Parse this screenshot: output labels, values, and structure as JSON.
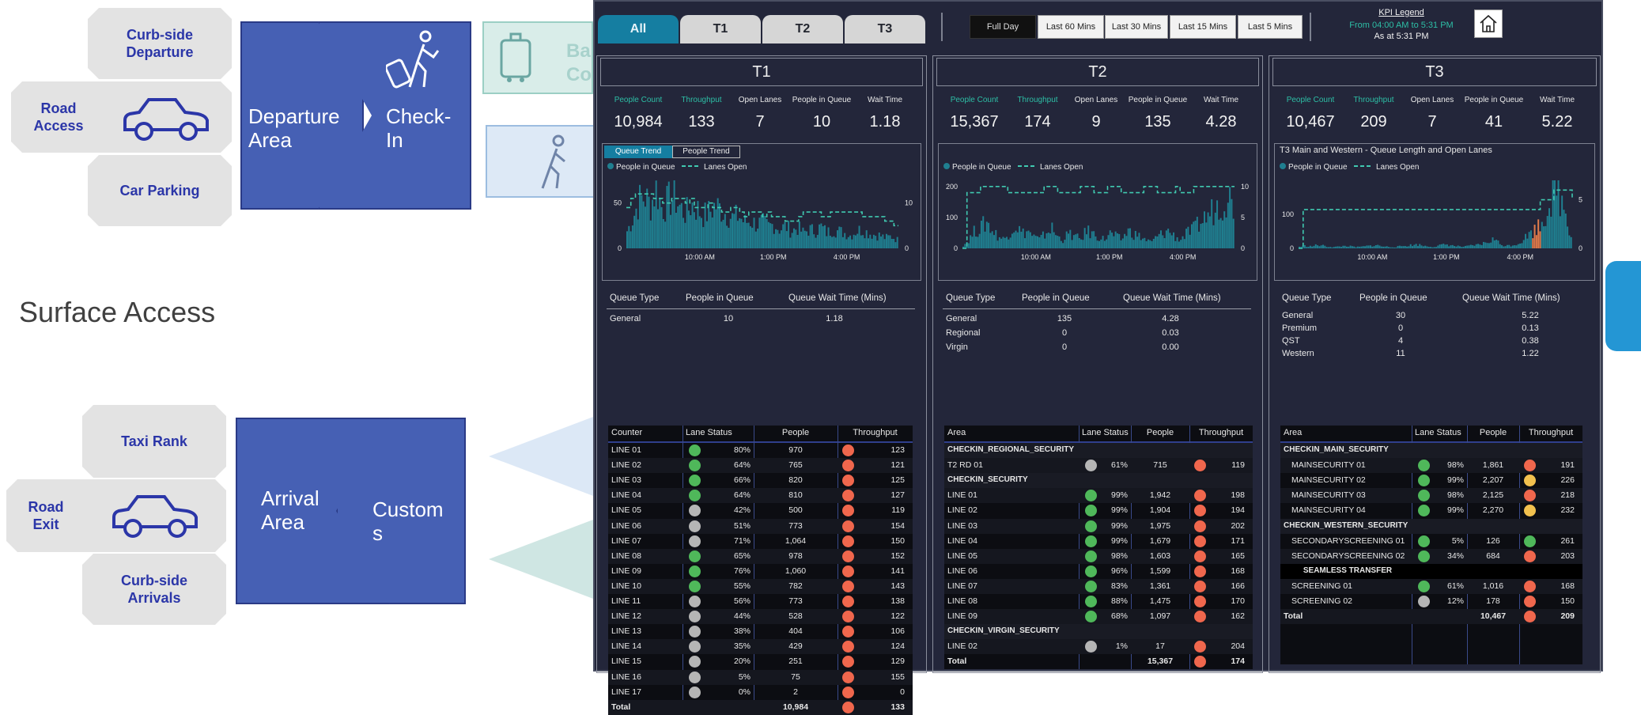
{
  "diagram": {
    "departure": {
      "tickets": [
        "Curb-side Departure",
        "Road Access",
        "Car Parking"
      ],
      "area_label": "Departure Area",
      "next_label": "Check-In"
    },
    "surface_access": "Surface Access",
    "arrival": {
      "tickets": [
        "Taxi Rank",
        "Road Exit",
        "Curb-side Arrivals"
      ],
      "area_label": "Arrival Area",
      "next_label": "Customs"
    },
    "partial_labels": [
      "Ba",
      "Co"
    ]
  },
  "dashboard": {
    "tabs": [
      "All",
      "T1",
      "T2",
      "T3"
    ],
    "active_tab": "All",
    "time_buttons": [
      "Full Day",
      "Last 60 Mins",
      "Last 30 Mins",
      "Last 15 Mins",
      "Last 5 Mins"
    ],
    "active_time": "Full Day",
    "kpi_legend": {
      "title": "KPI Legend",
      "range": "From 04:00 AM to 5:31 PM",
      "as_at": "As at 5:31 PM"
    },
    "home_icon": "home-icon",
    "colors": {
      "teal": "#2dbfa6",
      "bar": "#1f7f90",
      "lane": "#40c9b0",
      "green": "#4fb85a",
      "grey": "#b5b5b5",
      "red": "#f0674d",
      "yellow": "#f2c14e",
      "highlight": "#e07a4a"
    },
    "panels": [
      {
        "title": "T1",
        "kpi_labels": [
          "People Count",
          "Throughput",
          "Open Lanes",
          "People in Queue",
          "Wait Time"
        ],
        "kpi_values": [
          "10,984",
          "133",
          "7",
          "10",
          "1.18"
        ],
        "chart_tabs": [
          "Queue Trend",
          "People Trend"
        ],
        "chart_title": "",
        "legend": [
          "People in Queue",
          "Lanes Open"
        ],
        "queue_headers": [
          "Queue Type",
          "People in Queue",
          "Queue Wait Time (Mins)"
        ],
        "queue_rows": [
          [
            "General",
            "10",
            "1.18"
          ]
        ],
        "table_headers": [
          "Counter",
          "Lane Status",
          "People",
          "Throughput"
        ],
        "rows": [
          {
            "name": "LINE 01",
            "pct": "80%",
            "status": "g",
            "people": "970",
            "tp_status": "r",
            "tp": "123"
          },
          {
            "name": "LINE 02",
            "pct": "64%",
            "status": "g",
            "people": "765",
            "tp_status": "r",
            "tp": "121"
          },
          {
            "name": "LINE 03",
            "pct": "66%",
            "status": "g",
            "people": "820",
            "tp_status": "r",
            "tp": "125"
          },
          {
            "name": "LINE 04",
            "pct": "64%",
            "status": "g",
            "people": "810",
            "tp_status": "r",
            "tp": "127"
          },
          {
            "name": "LINE 05",
            "pct": "42%",
            "status": "s",
            "people": "500",
            "tp_status": "r",
            "tp": "119"
          },
          {
            "name": "LINE 06",
            "pct": "51%",
            "status": "s",
            "people": "773",
            "tp_status": "r",
            "tp": "154"
          },
          {
            "name": "LINE 07",
            "pct": "71%",
            "status": "s",
            "people": "1,064",
            "tp_status": "r",
            "tp": "150"
          },
          {
            "name": "LINE 08",
            "pct": "65%",
            "status": "g",
            "people": "978",
            "tp_status": "r",
            "tp": "152"
          },
          {
            "name": "LINE 09",
            "pct": "76%",
            "status": "g",
            "people": "1,060",
            "tp_status": "r",
            "tp": "141"
          },
          {
            "name": "LINE 10",
            "pct": "55%",
            "status": "g",
            "people": "782",
            "tp_status": "r",
            "tp": "143"
          },
          {
            "name": "LINE 11",
            "pct": "56%",
            "status": "s",
            "people": "773",
            "tp_status": "r",
            "tp": "138"
          },
          {
            "name": "LINE 12",
            "pct": "44%",
            "status": "s",
            "people": "528",
            "tp_status": "r",
            "tp": "122"
          },
          {
            "name": "LINE 13",
            "pct": "38%",
            "status": "s",
            "people": "404",
            "tp_status": "r",
            "tp": "106"
          },
          {
            "name": "LINE 14",
            "pct": "35%",
            "status": "s",
            "people": "429",
            "tp_status": "r",
            "tp": "124"
          },
          {
            "name": "LINE 15",
            "pct": "20%",
            "status": "s",
            "people": "251",
            "tp_status": "r",
            "tp": "129"
          },
          {
            "name": "LINE 16",
            "pct": "5%",
            "status": "s",
            "people": "75",
            "tp_status": "r",
            "tp": "155"
          },
          {
            "name": "LINE 17",
            "pct": "0%",
            "status": "s",
            "people": "2",
            "tp_status": "r",
            "tp": "0"
          },
          {
            "name": "Total",
            "pct": "",
            "status": "",
            "people": "10,984",
            "tp_status": "r",
            "tp": "133",
            "bold": true
          }
        ]
      },
      {
        "title": "T2",
        "kpi_labels": [
          "People Count",
          "Throughput",
          "Open Lanes",
          "People in Queue",
          "Wait Time"
        ],
        "kpi_values": [
          "15,367",
          "174",
          "9",
          "135",
          "4.28"
        ],
        "chart_tabs": [],
        "chart_title": "",
        "legend": [
          "People in Queue",
          "Lanes Open"
        ],
        "queue_headers": [
          "Queue Type",
          "People in Queue",
          "Queue Wait Time (Mins)"
        ],
        "queue_rows": [
          [
            "General",
            "135",
            "4.28"
          ],
          [
            "Regional",
            "0",
            "0.03"
          ],
          [
            "Virgin",
            "0",
            "0.00"
          ]
        ],
        "table_headers": [
          "Area",
          "Lane Status",
          "People",
          "Throughput"
        ],
        "rows": [
          {
            "name": "CHECKIN_REGIONAL_SECURITY",
            "group": true
          },
          {
            "name": "T2 RD 01",
            "pct": "61%",
            "status": "s",
            "people": "715",
            "tp_status": "r",
            "tp": "119"
          },
          {
            "name": "CHECKIN_SECURITY",
            "group": true
          },
          {
            "name": "LINE 01",
            "pct": "99%",
            "status": "g",
            "people": "1,942",
            "tp_status": "r",
            "tp": "198"
          },
          {
            "name": "LINE 02",
            "pct": "99%",
            "status": "g",
            "people": "1,904",
            "tp_status": "r",
            "tp": "194"
          },
          {
            "name": "LINE 03",
            "pct": "99%",
            "status": "g",
            "people": "1,975",
            "tp_status": "r",
            "tp": "202"
          },
          {
            "name": "LINE 04",
            "pct": "99%",
            "status": "g",
            "people": "1,679",
            "tp_status": "r",
            "tp": "171"
          },
          {
            "name": "LINE 05",
            "pct": "98%",
            "status": "g",
            "people": "1,603",
            "tp_status": "r",
            "tp": "165"
          },
          {
            "name": "LINE 06",
            "pct": "96%",
            "status": "g",
            "people": "1,599",
            "tp_status": "r",
            "tp": "168"
          },
          {
            "name": "LINE 07",
            "pct": "83%",
            "status": "g",
            "people": "1,361",
            "tp_status": "r",
            "tp": "166"
          },
          {
            "name": "LINE 08",
            "pct": "88%",
            "status": "g",
            "people": "1,475",
            "tp_status": "r",
            "tp": "170"
          },
          {
            "name": "LINE 09",
            "pct": "68%",
            "status": "g",
            "people": "1,097",
            "tp_status": "r",
            "tp": "162"
          },
          {
            "name": "CHECKIN_VIRGIN_SECURITY",
            "group": true
          },
          {
            "name": "LINE 02",
            "pct": "1%",
            "status": "s",
            "people": "17",
            "tp_status": "r",
            "tp": "204"
          },
          {
            "name": "Total",
            "pct": "",
            "status": "",
            "people": "15,367",
            "tp_status": "r",
            "tp": "174",
            "bold": true
          }
        ]
      },
      {
        "title": "T3",
        "kpi_labels": [
          "People Count",
          "Throughput",
          "Open Lanes",
          "People in Queue",
          "Wait Time"
        ],
        "kpi_values": [
          "10,467",
          "209",
          "7",
          "41",
          "5.22"
        ],
        "chart_tabs": [],
        "chart_title": "T3 Main and Western - Queue Length and Open Lanes",
        "legend": [
          "People in Queue",
          "Lanes Open"
        ],
        "queue_headers": [
          "Queue Type",
          "People in Queue",
          "Queue Wait Time (Mins)"
        ],
        "queue_rows": [
          [
            "General",
            "30",
            "5.22"
          ],
          [
            "Premium",
            "0",
            "0.13"
          ],
          [
            "QST",
            "4",
            "0.38"
          ],
          [
            "Western",
            "11",
            "1.22"
          ]
        ],
        "table_headers": [
          "Area",
          "Lane Status",
          "People",
          "Throughput"
        ],
        "rows": [
          {
            "name": "CHECKIN_MAIN_SECURITY",
            "group": true
          },
          {
            "name": "MAINSECURITY 01",
            "pct": "98%",
            "status": "g",
            "people": "1,861",
            "tp_status": "r",
            "tp": "191"
          },
          {
            "name": "MAINSECURITY 02",
            "pct": "99%",
            "status": "g",
            "people": "2,207",
            "tp_status": "y",
            "tp": "226"
          },
          {
            "name": "MAINSECURITY 03",
            "pct": "98%",
            "status": "g",
            "people": "2,125",
            "tp_status": "r",
            "tp": "218"
          },
          {
            "name": "MAINSECURITY 04",
            "pct": "99%",
            "status": "g",
            "people": "2,270",
            "tp_status": "y",
            "tp": "232"
          },
          {
            "name": "CHECKIN_WESTERN_SECURITY",
            "group": true
          },
          {
            "name": "SECONDARYSCREENING 01",
            "pct": "5%",
            "status": "g",
            "people": "126",
            "tp_status": "g",
            "tp": "261"
          },
          {
            "name": "SECONDARYSCREENING 02",
            "pct": "34%",
            "status": "g",
            "people": "684",
            "tp_status": "r",
            "tp": "203"
          },
          {
            "name": "SEAMLESS TRANSFER",
            "group": true,
            "center": true
          },
          {
            "name": "SCREENING 01",
            "pct": "61%",
            "status": "g",
            "people": "1,016",
            "tp_status": "r",
            "tp": "168"
          },
          {
            "name": "SCREENING 02",
            "pct": "12%",
            "status": "s",
            "people": "178",
            "tp_status": "r",
            "tp": "150"
          },
          {
            "name": "Total",
            "pct": "",
            "status": "",
            "people": "10,467",
            "tp_status": "r",
            "tp": "209",
            "bold": true
          }
        ]
      }
    ]
  },
  "chart_data": [
    {
      "type": "area",
      "series": [
        {
          "name": "People in Queue"
        },
        {
          "name": "Lanes Open"
        }
      ],
      "x_ticks": [
        "10:00 AM",
        "1:00 PM",
        "4:00 PM"
      ],
      "y_ticks_left": [
        0,
        50
      ],
      "y_ticks_right": [
        0,
        10
      ],
      "ylim_left": [
        0,
        75
      ],
      "ylim_right": [
        0,
        15
      ],
      "people_profile": [
        20,
        35,
        55,
        60,
        50,
        70,
        45,
        55,
        60,
        48,
        40,
        52,
        45,
        38,
        42,
        50,
        45,
        40,
        35,
        38,
        30,
        32,
        28,
        30,
        25,
        28,
        22,
        26,
        20,
        24,
        18,
        22,
        20,
        25,
        18,
        22,
        20,
        18,
        15,
        20,
        22,
        18,
        16,
        15,
        12,
        14,
        10
      ],
      "lanes_profile": [
        9,
        11,
        12,
        12,
        12,
        11,
        10,
        10,
        11,
        11,
        10,
        11,
        9,
        9,
        10,
        9,
        8,
        8,
        9,
        8,
        7,
        8,
        8,
        7,
        8,
        7,
        7,
        6,
        6,
        7,
        8,
        8,
        8,
        7,
        7,
        8,
        8,
        8,
        8,
        8,
        7,
        7,
        7,
        7,
        6,
        5,
        5
      ]
    },
    {
      "type": "area",
      "series": [
        {
          "name": "People in Queue"
        },
        {
          "name": "Lanes Open"
        }
      ],
      "x_ticks": [
        "10:00 AM",
        "1:00 PM",
        "4:00 PM"
      ],
      "y_ticks_left": [
        0,
        100,
        200
      ],
      "y_ticks_right": [
        0,
        5,
        10
      ],
      "ylim_left": [
        0,
        220
      ],
      "ylim_right": [
        0,
        11
      ],
      "people_profile": [
        10,
        30,
        60,
        70,
        90,
        60,
        40,
        30,
        60,
        80,
        50,
        60,
        40,
        30,
        50,
        70,
        40,
        30,
        50,
        40,
        30,
        60,
        50,
        40,
        30,
        50,
        40,
        30,
        60,
        50,
        40,
        30,
        20,
        40,
        50,
        60,
        40,
        30,
        50,
        60,
        80,
        100,
        120,
        140,
        160,
        180,
        150
      ],
      "lanes_profile": [
        0,
        9,
        9,
        10,
        10,
        10,
        10,
        10,
        9,
        9,
        9,
        9,
        9,
        9,
        10,
        10,
        9,
        9,
        9,
        9,
        10,
        10,
        9,
        9,
        9,
        10,
        10,
        9,
        9,
        9,
        9,
        10,
        10,
        9,
        9,
        9,
        10,
        9,
        9,
        10,
        10,
        10,
        10,
        10,
        10,
        10,
        10
      ]
    },
    {
      "type": "area",
      "title": "T3 Main and Western - Queue Length and Open Lanes",
      "series": [
        {
          "name": "People in Queue"
        },
        {
          "name": "Lanes Open"
        }
      ],
      "x_ticks": [
        "10:00 AM",
        "1:00 PM",
        "4:00 PM"
      ],
      "y_ticks_left": [
        0,
        100
      ],
      "y_ticks_right": [
        0,
        5
      ],
      "ylim_left": [
        0,
        200
      ],
      "ylim_right": [
        0,
        7
      ],
      "people_profile": [
        5,
        8,
        6,
        10,
        8,
        5,
        4,
        6,
        8,
        5,
        4,
        6,
        8,
        10,
        6,
        5,
        4,
        6,
        8,
        10,
        12,
        8,
        6,
        5,
        10,
        12,
        8,
        6,
        5,
        8,
        10,
        14,
        20,
        30,
        12,
        8,
        10,
        14,
        30,
        45,
        60,
        80,
        120,
        190,
        160,
        120,
        40
      ],
      "lanes_profile": [
        0,
        4,
        4,
        4,
        4,
        4,
        4,
        4,
        4,
        4,
        4,
        4,
        4,
        4,
        4,
        4,
        4,
        4,
        4,
        4,
        4,
        4,
        4,
        4,
        4,
        4,
        4,
        4,
        4,
        4,
        4,
        4,
        4,
        4,
        4,
        4,
        4,
        4,
        4,
        4,
        4,
        5,
        5,
        6,
        6,
        6,
        5
      ]
    }
  ]
}
